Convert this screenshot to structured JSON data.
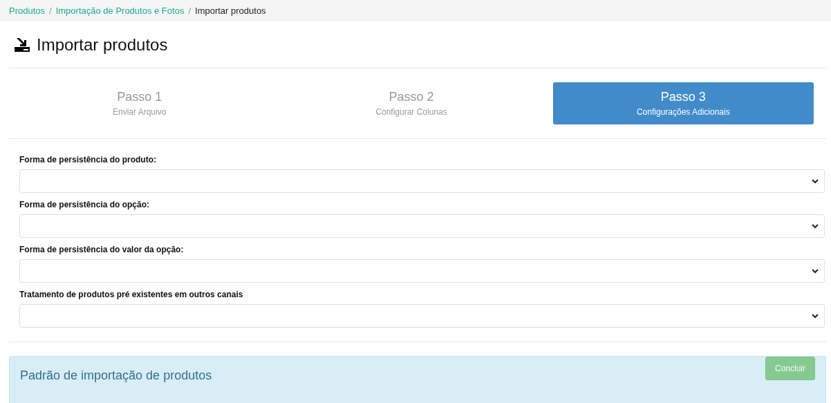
{
  "breadcrumb_separator": "/",
  "breadcrumb": [
    {
      "label": "Produtos",
      "current": false
    },
    {
      "label": "Importação de Produtos e Fotos",
      "current": false
    },
    {
      "label": "Importar produtos",
      "current": true
    }
  ],
  "page_title": "Importar produtos",
  "steps": [
    {
      "title": "Passo 1",
      "subtitle": "Enviar Arquivo",
      "selected": false
    },
    {
      "title": "Passo 2",
      "subtitle": "Configurar Colunas",
      "selected": false
    },
    {
      "title": "Passo 3",
      "subtitle": "Configurações Adicionais",
      "selected": true
    }
  ],
  "fields": [
    {
      "label": "Forma de persistência do produto:"
    },
    {
      "label": "Forma de persistência do opção:"
    },
    {
      "label": "Forma de persistência do valor da opção:"
    },
    {
      "label": "Tratamento de produtos pré existentes em outros canais"
    }
  ],
  "info_panel": {
    "title": "Padrão de importação de produtos"
  },
  "finish_button": {
    "label": "Concluir",
    "disabled": true
  }
}
